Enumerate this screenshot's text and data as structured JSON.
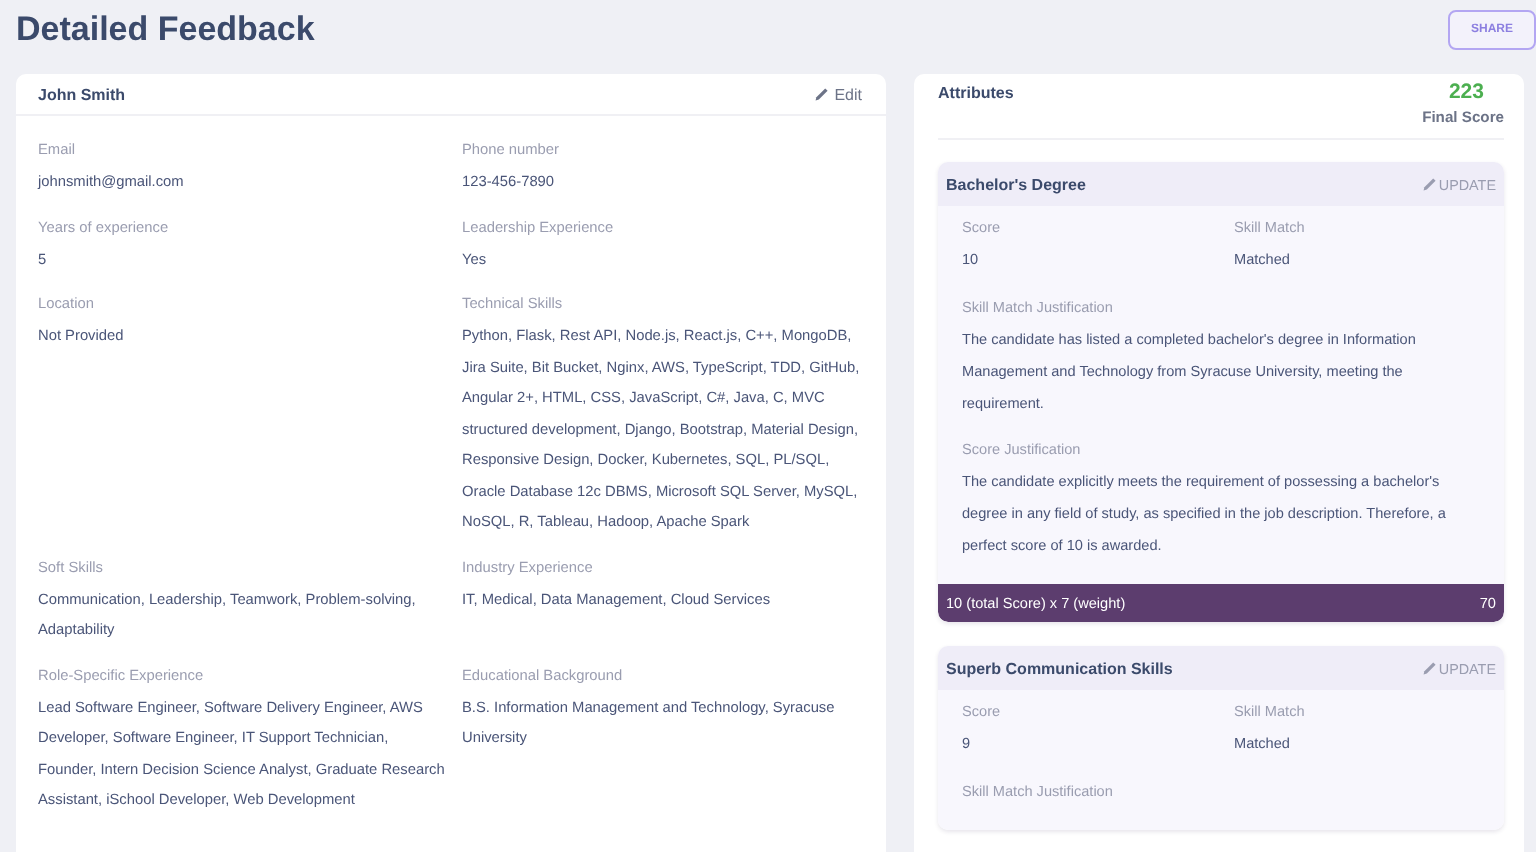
{
  "page": {
    "title": "Detailed Feedback",
    "share_label": "SHARE"
  },
  "profile": {
    "name": "John Smith",
    "edit_label": "Edit",
    "fields": [
      {
        "label": "Email",
        "value": "johnsmith@gmail.com"
      },
      {
        "label": "Phone number",
        "value": "123-456-7890"
      },
      {
        "label": "Years of experience",
        "value": "5"
      },
      {
        "label": "Leadership Experience",
        "value": "Yes"
      },
      {
        "label": "Location",
        "value": "Not Provided"
      },
      {
        "label": "Technical Skills",
        "value": "Python, Flask, Rest API, Node.js, React.js, C++, MongoDB, Jira Suite, Bit Bucket, Nginx, AWS, TypeScript, TDD, GitHub, Angular 2+, HTML, CSS, JavaScript, C#, Java, C, MVC structured development, Django, Bootstrap, Material Design, Responsive Design, Docker, Kubernetes, SQL, PL/SQL, Oracle Database 12c DBMS, Microsoft SQL Server, MySQL, NoSQL, R, Tableau, Hadoop, Apache Spark"
      },
      {
        "label": "Soft Skills",
        "value": "Communication, Leadership, Teamwork, Problem-solving, Adaptability"
      },
      {
        "label": "Industry Experience",
        "value": "IT, Medical, Data Management, Cloud Services"
      },
      {
        "label": "Role-Specific Experience",
        "value": "Lead Software Engineer, Software Delivery Engineer, AWS Developer, Software Engineer, IT Support Technician, Founder, Intern Decision Science Analyst, Graduate Research Assistant, iSchool Developer, Web Development"
      },
      {
        "label": "Educational Background",
        "value": "B.S. Information Management and Technology, Syracuse University"
      }
    ]
  },
  "attributes": {
    "title": "Attributes",
    "final_score": "223",
    "final_score_label": "Final Score",
    "items": [
      {
        "title": "Bachelor's Degree",
        "update_label": "UPDATE",
        "score_label": "Score",
        "score": "10",
        "skill_match_label": "Skill Match",
        "skill_match": "Matched",
        "justifications": [
          {
            "label": "Skill Match Justification",
            "text": "The candidate has listed a completed bachelor's degree in Information Management and Technology from Syracuse University, meeting the requirement."
          },
          {
            "label": "Score Justification",
            "text": "The candidate explicitly meets the requirement of possessing a bachelor's degree in any field of study, as specified in the job description. Therefore, a perfect score of 10 is awarded."
          }
        ],
        "formula": "10 (total Score) x 7 (weight)",
        "points": "70"
      },
      {
        "title": "Superb Communication Skills",
        "update_label": "UPDATE",
        "score_label": "Score",
        "score": "9",
        "skill_match_label": "Skill Match",
        "skill_match": "Matched",
        "justifications": [
          {
            "label": "Skill Match Justification"
          }
        ]
      }
    ]
  }
}
